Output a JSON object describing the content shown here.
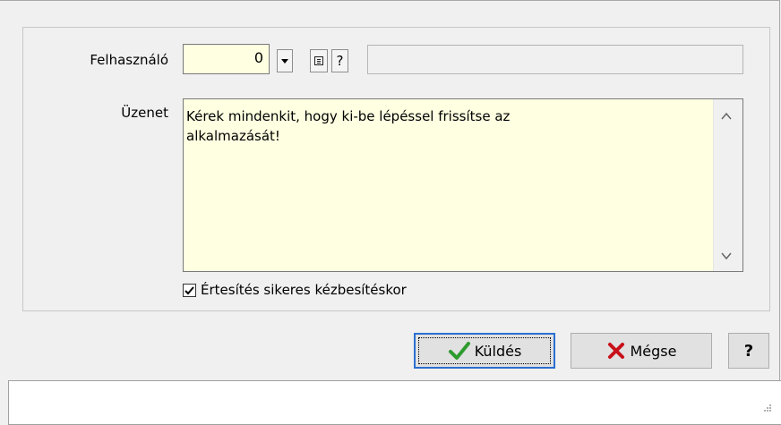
{
  "form": {
    "user_label": "Felhasználó",
    "user_value": "0",
    "help_small": "?",
    "message_label": "Üzenet",
    "message_text": "Kérek mindenkit, hogy ki-be lépéssel frissítse az\nalkalmazását!",
    "notify_label": "Értesítés sikeres kézbesítéskor",
    "notify_checked": true
  },
  "buttons": {
    "send": "Küldés",
    "cancel": "Mégse",
    "help": "?"
  },
  "colors": {
    "input_bg": "#ffffe1",
    "check_green": "#2e9b2e",
    "cross_red": "#c8101a"
  },
  "icons": [
    "dropdown-arrow-icon",
    "list-icon",
    "check-icon",
    "cross-icon",
    "scroll-up-icon",
    "scroll-down-icon",
    "resize-grip-icon"
  ]
}
